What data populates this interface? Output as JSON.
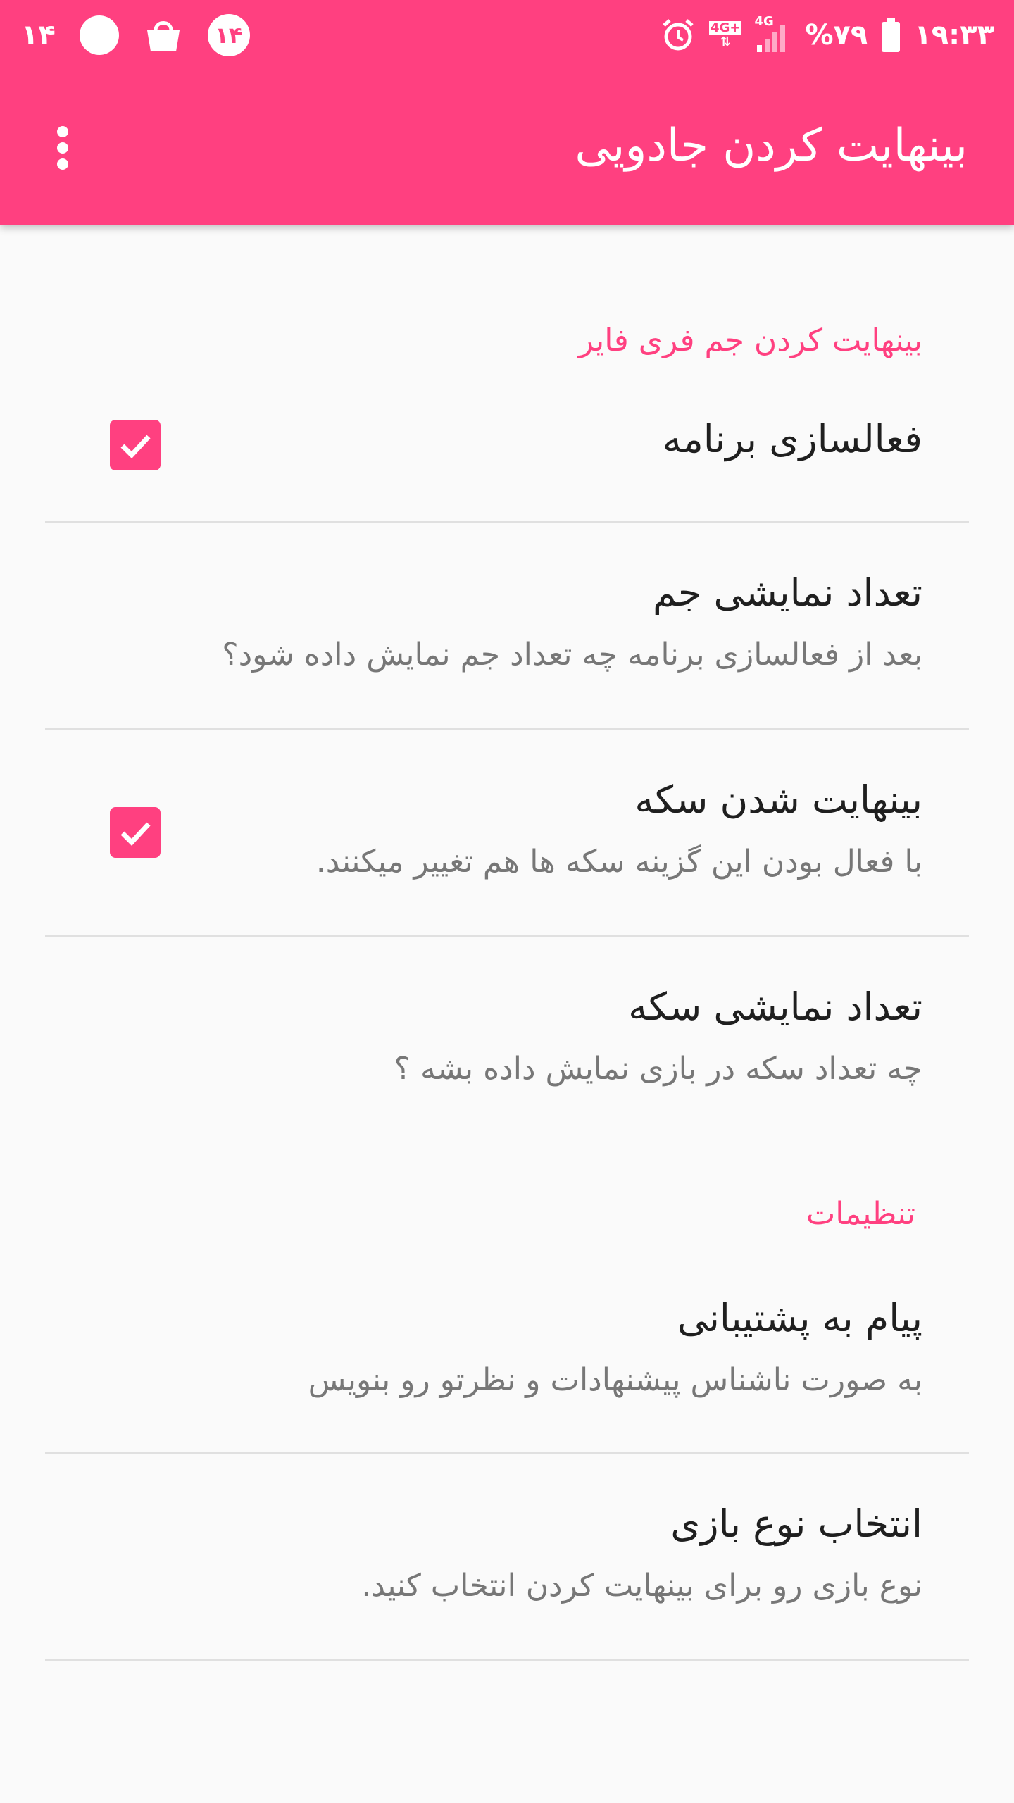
{
  "status_bar": {
    "notif_count": "۱۴",
    "badge": "۱۴",
    "network_4g_plus": "4G+",
    "network_4g": "4G",
    "battery": "%۷۹",
    "time": "۱۹:۳۳"
  },
  "toolbar": {
    "title": "بینهایت کردن جادویی",
    "menu_icon": "more-vert-icon"
  },
  "sections": [
    {
      "header": "بینهایت کردن جم فری فایر",
      "items": [
        {
          "title": "فعالسازی برنامه",
          "summary": "",
          "checked": true
        },
        {
          "title": "تعداد نمایشی جم",
          "summary": "بعد از فعالسازی برنامه چه تعداد جم نمایش داده شود؟"
        },
        {
          "title": "بینهایت شدن سکه",
          "summary": "با فعال بودن این گزینه سکه ها هم تغییر میکنند.",
          "checked": true
        },
        {
          "title": "تعداد نمایشی سکه",
          "summary": "چه تعداد سکه در بازی نمایش داده بشه ؟"
        }
      ]
    },
    {
      "header": "تنظیمات",
      "items": [
        {
          "title": "پیام به پشتیبانی",
          "summary": "به صورت ناشناس پیشنهادات و نظرتو رو بنویس"
        },
        {
          "title": "انتخاب نوع بازی",
          "summary": "نوع بازی رو برای بینهایت کردن انتخاب کنید."
        }
      ]
    }
  ],
  "colors": {
    "accent": "#ff4080",
    "background": "#fafafa",
    "title_text": "#1f1f1f",
    "summary_text": "#777777",
    "divider": "#e0e0e0"
  }
}
